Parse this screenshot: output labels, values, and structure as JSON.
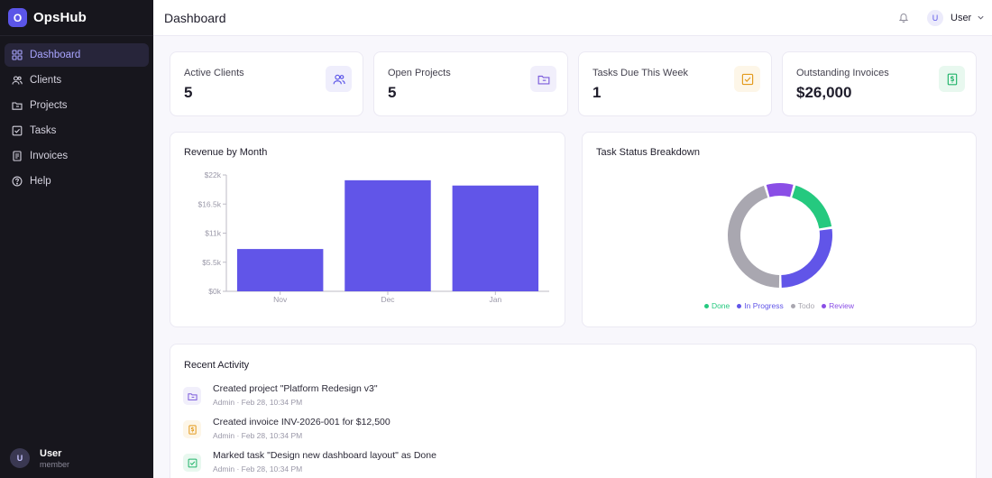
{
  "brand": {
    "logo_letter": "O",
    "name": "OpsHub"
  },
  "sidebar": {
    "items": [
      {
        "label": "Dashboard",
        "icon": "grid-icon",
        "active": true
      },
      {
        "label": "Clients",
        "icon": "users-icon"
      },
      {
        "label": "Projects",
        "icon": "folder-icon"
      },
      {
        "label": "Tasks",
        "icon": "check-square-icon"
      },
      {
        "label": "Invoices",
        "icon": "receipt-icon"
      },
      {
        "label": "Help",
        "icon": "help-circle-icon"
      }
    ],
    "user": {
      "initial": "U",
      "name": "User",
      "role": "member"
    }
  },
  "header": {
    "title": "Dashboard",
    "user": {
      "initial": "U",
      "name": "User"
    }
  },
  "stats": [
    {
      "label": "Active Clients",
      "value": "5",
      "icon": "users-icon",
      "color": "#5b55e8",
      "bg": "#efeefc"
    },
    {
      "label": "Open Projects",
      "value": "5",
      "icon": "folder-icon",
      "color": "#7c5cdb",
      "bg": "#f1effb"
    },
    {
      "label": "Tasks Due This Week",
      "value": "1",
      "icon": "check-square-icon",
      "color": "#e39a1c",
      "bg": "#fdf6e8"
    },
    {
      "label": "Outstanding Invoices",
      "value": "$26,000",
      "icon": "dollar-doc-icon",
      "color": "#22b46b",
      "bg": "#e8f8ef"
    }
  ],
  "revenue": {
    "title": "Revenue by Month"
  },
  "task_status": {
    "title": "Task Status Breakdown"
  },
  "chart_data": [
    {
      "type": "bar",
      "title": "Revenue by Month",
      "categories": [
        "Nov",
        "Dec",
        "Jan"
      ],
      "values": [
        8000,
        21000,
        20000
      ],
      "ylim": [
        0,
        22000
      ],
      "yticks": [
        "$0k",
        "$5.5k",
        "$11k",
        "$16.5k",
        "$22k"
      ],
      "color": "#6155e8"
    },
    {
      "type": "pie",
      "title": "Task Status Breakdown",
      "labels": [
        "Done",
        "In Progress",
        "Todo",
        "Review"
      ],
      "values": [
        2,
        3,
        5,
        1
      ],
      "colors": [
        "#25c97f",
        "#6155e8",
        "#a9a7b0",
        "#8a4ee6"
      ],
      "legend": "bottom"
    }
  ],
  "activity": {
    "title": "Recent Activity",
    "items": [
      {
        "text": "Created project \"Platform Redesign v3\"",
        "meta": "Admin · Feb 28, 10:34 PM",
        "icon": "folder-icon",
        "color": "#7c5cdb",
        "bg": "#f1effb"
      },
      {
        "text": "Created invoice INV-2026-001 for $12,500",
        "meta": "Admin · Feb 28, 10:34 PM",
        "icon": "dollar-doc-icon",
        "color": "#e39a1c",
        "bg": "#fdf6e8"
      },
      {
        "text": "Marked task \"Design new dashboard layout\" as Done",
        "meta": "Admin · Feb 28, 10:34 PM",
        "icon": "check-square-icon",
        "color": "#22b46b",
        "bg": "#e8f8ef"
      }
    ]
  }
}
